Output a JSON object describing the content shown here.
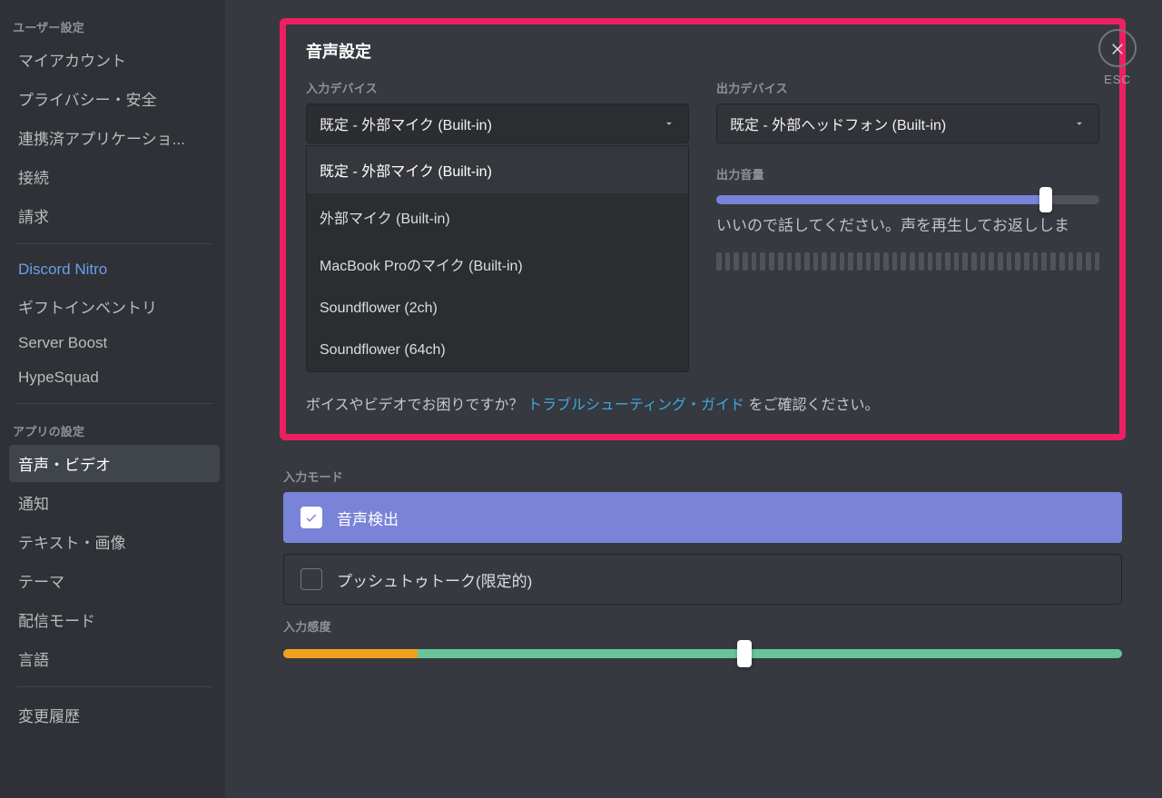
{
  "close": {
    "esc_label": "ESC"
  },
  "sidebar": {
    "section_user": "ユーザー設定",
    "section_app": "アプリの設定",
    "items_user": [
      "マイアカウント",
      "プライバシー・安全",
      "連携済アプリケーショ...",
      "接続",
      "請求"
    ],
    "nitro": "Discord Nitro",
    "items_nitro": [
      "ギフトインベントリ",
      "Server Boost",
      "HypeSquad"
    ],
    "items_app": [
      "音声・ビデオ",
      "通知",
      "テキスト・画像",
      "テーマ",
      "配信モード",
      "言語"
    ],
    "changelog": "変更履歴"
  },
  "voice": {
    "title": "音声設定",
    "input_label": "入力デバイス",
    "output_label": "出力デバイス",
    "input_selected": "既定 - 外部マイク (Built-in)",
    "output_selected": "既定 - 外部ヘッドフォン (Built-in)",
    "output_volume_label": "出力音量",
    "output_volume_percent": 86,
    "input_options": [
      "既定 - 外部マイク (Built-in)",
      "外部マイク (Built-in)",
      "MacBook Proのマイク (Built-in)",
      "Soundflower (2ch)",
      "Soundflower (64ch)"
    ],
    "mic_hint_partial": "いいので話してください。声を再生してお返ししま",
    "help_before": "ボイスやビデオでお困りですか？ ",
    "help_link": "トラブルシューティング・ガイド",
    "help_after": " をご確認ください。"
  },
  "mode": {
    "label": "入力モード",
    "activity": "音声検出",
    "ptt": "プッシュトゥトーク(限定的)"
  },
  "sensitivity": {
    "label": "入力感度",
    "orange_percent": 16,
    "thumb_percent": 55
  }
}
